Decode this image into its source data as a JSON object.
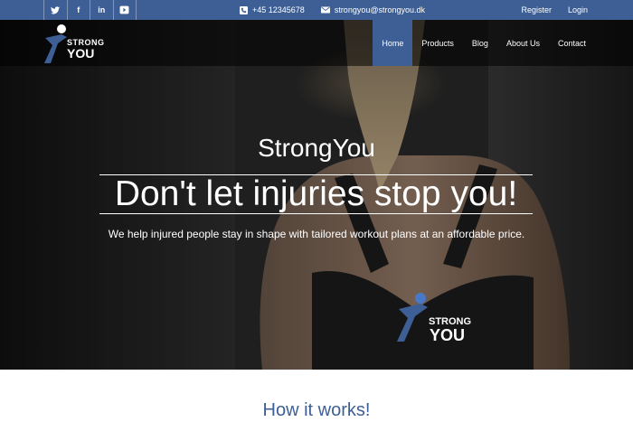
{
  "topbar": {
    "social": [
      {
        "icon": "twitter-icon",
        "glyph": "🐦"
      },
      {
        "icon": "facebook-icon",
        "glyph": "f"
      },
      {
        "icon": "linkedin-icon",
        "glyph": "in"
      },
      {
        "icon": "youtube-icon",
        "glyph": "▶"
      }
    ],
    "phone": "+45 12345678",
    "email": "strongyou@strongyou.dk",
    "register": "Register",
    "login": "Login"
  },
  "nav": {
    "logo_line1": "STRONG",
    "logo_line2": "YOU",
    "items": [
      {
        "label": "Home",
        "active": true
      },
      {
        "label": "Products",
        "active": false
      },
      {
        "label": "Blog",
        "active": false
      },
      {
        "label": "About Us",
        "active": false
      },
      {
        "label": "Contact",
        "active": false
      }
    ]
  },
  "hero": {
    "brand": "StrongYou",
    "headline": "Don't let injuries stop you!",
    "subtext": "We help injured people stay in shape with tailored workout plans at an affordable price.",
    "shirt_logo_line1": "STRONG",
    "shirt_logo_line2": "YOU"
  },
  "section": {
    "title": "How it works!"
  },
  "colors": {
    "accent": "#3d5f95"
  }
}
